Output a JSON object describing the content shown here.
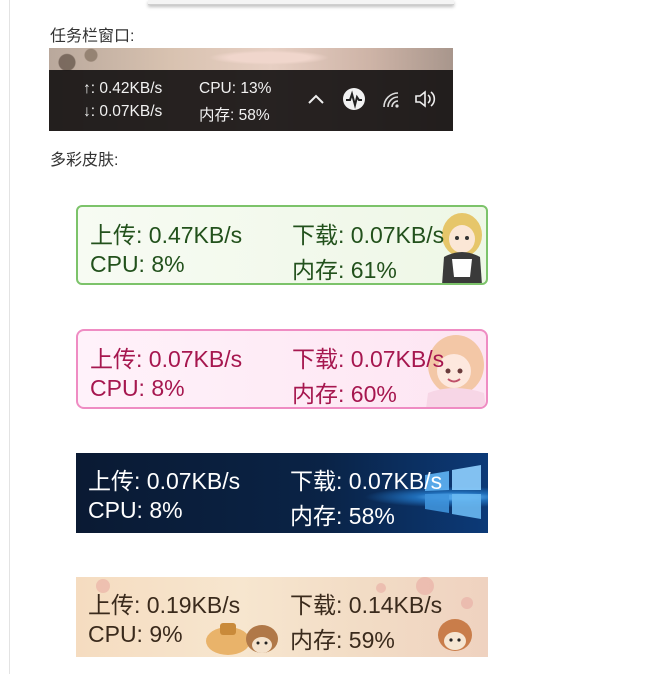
{
  "labels": {
    "taskbar_heading": "任务栏窗口:",
    "skins_heading": "多彩皮肤:"
  },
  "taskbar": {
    "upload": "↑: 0.42KB/s",
    "download": "↓: 0.07KB/s",
    "cpu": "CPU: 13%",
    "memory": "内存: 58%",
    "tray_icons": [
      "chevron-up-icon",
      "monitor-app-icon",
      "wifi-icon",
      "speaker-icon"
    ]
  },
  "skins": [
    {
      "name": "green",
      "upload": "上传: 0.47KB/s",
      "download": "下载: 0.07KB/s",
      "cpu": "CPU: 8%",
      "memory": "内存: 61%",
      "text_color": "#22511c",
      "border_color": "#7cc36a"
    },
    {
      "name": "pink",
      "upload": "上传: 0.07KB/s",
      "download": "下载: 0.07KB/s",
      "cpu": "CPU: 8%",
      "memory": "内存: 60%",
      "text_color": "#a6174f",
      "border_color": "#ef8cc3"
    },
    {
      "name": "blue",
      "upload": "上传: 0.07KB/s",
      "download": "下载: 0.07KB/s",
      "cpu": "CPU: 8%",
      "memory": "内存: 58%",
      "text_color": "#ffffff",
      "border_color": "#0a2346"
    },
    {
      "name": "beige",
      "upload": "上传: 0.19KB/s",
      "download": "下载: 0.14KB/s",
      "cpu": "CPU: 9%",
      "memory": "内存: 59%",
      "text_color": "#3a2a1c",
      "border_color": "#f2dcc5"
    }
  ]
}
